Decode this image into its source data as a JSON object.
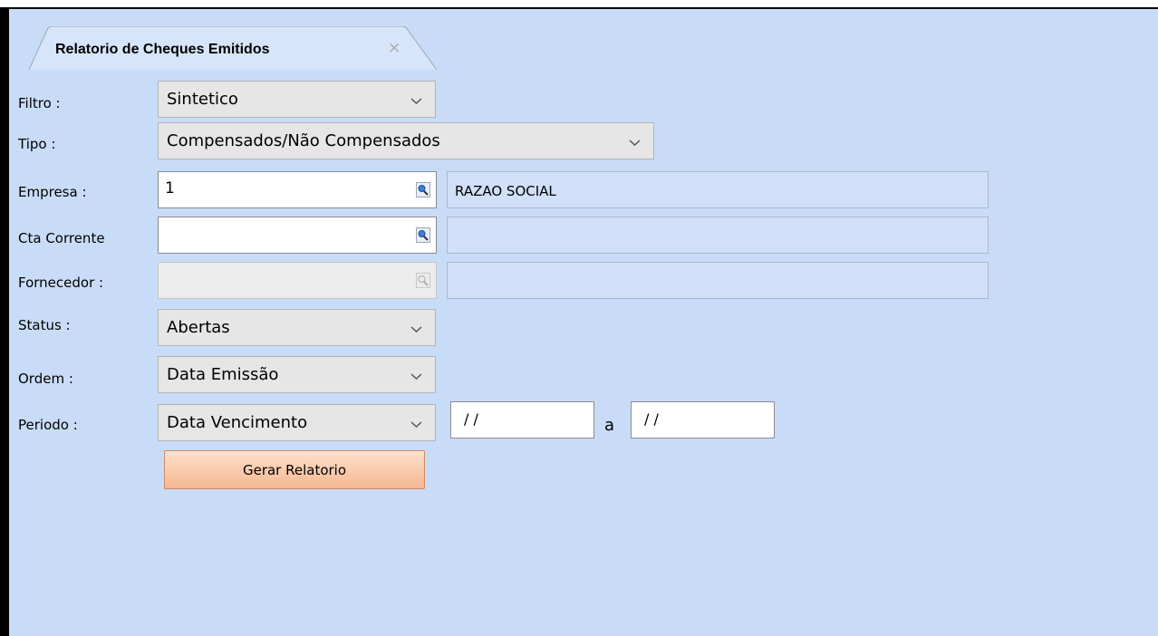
{
  "tab": {
    "title": "Relatorio de Cheques Emitidos",
    "close": "×"
  },
  "form": {
    "filtro": {
      "label": "Filtro :",
      "value": "Sintetico"
    },
    "tipo": {
      "label": "Tipo :",
      "value": "Compensados/Não Compensados"
    },
    "empresa": {
      "label": "Empresa :",
      "value": "1",
      "description": "RAZAO SOCIAL"
    },
    "cta_corrente": {
      "label": "Cta Corrente",
      "value": "",
      "description": ""
    },
    "fornecedor": {
      "label": "Fornecedor :",
      "value": "",
      "description": ""
    },
    "status": {
      "label": "Status :",
      "value": "Abertas"
    },
    "ordem": {
      "label": "Ordem :",
      "value": "Data Emissão"
    },
    "periodo": {
      "label": "Periodo :",
      "value": "Data Vencimento",
      "date_from": "/ /",
      "separator": "a",
      "date_to": "/ /"
    }
  },
  "actions": {
    "generate_label": "Gerar Relatorio"
  },
  "icons": {
    "lookup": "magnifier-icon",
    "dropdown": "chevron-down-icon",
    "close": "close-icon"
  },
  "colors": {
    "background": "#c9dcf7",
    "button": "#f6b892"
  }
}
